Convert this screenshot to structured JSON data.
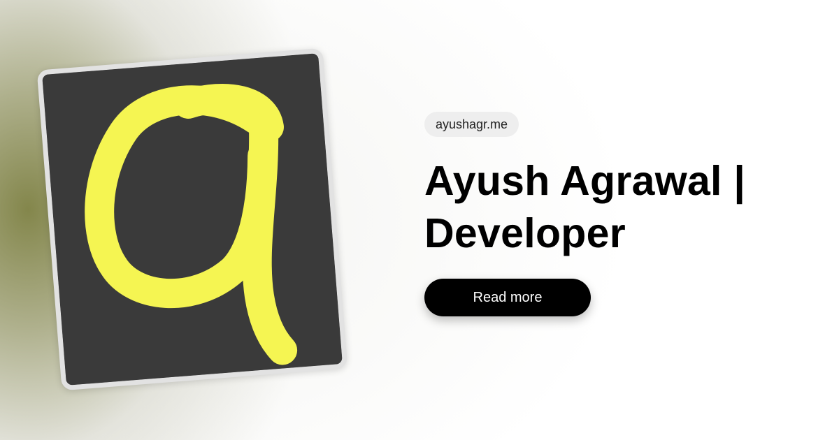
{
  "site": {
    "domain": "ayushagr.me"
  },
  "hero": {
    "title": "Ayush Agrawal | Developer",
    "cta_label": "Read more"
  },
  "logo": {
    "icon": "letter-a-logo-icon",
    "glyph": "a",
    "card_color": "#3a3a3a",
    "glyph_color": "#f5f552",
    "border_color": "#e2e2e2"
  },
  "colors": {
    "accent_glow": "#7d8042",
    "button_bg": "#000000",
    "button_text": "#ffffff",
    "pill_bg": "#eeeeee"
  }
}
